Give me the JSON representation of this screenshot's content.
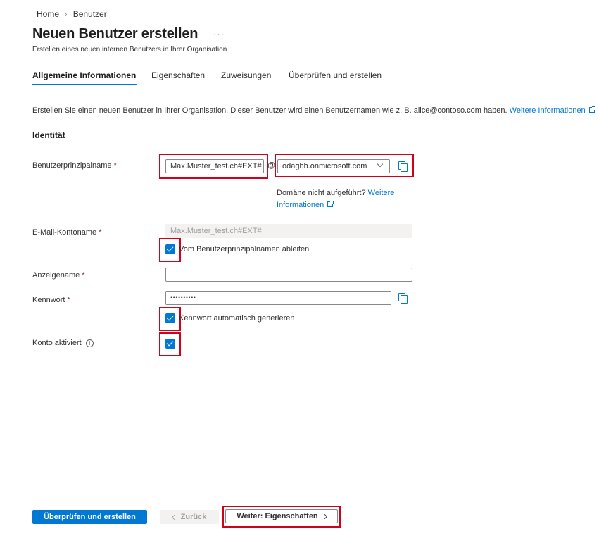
{
  "breadcrumb": {
    "home": "Home",
    "current": "Benutzer"
  },
  "header": {
    "title": "Neuen Benutzer erstellen",
    "more": "···",
    "subtitle": "Erstellen eines neuen internen Benutzers in Ihrer Organisation"
  },
  "tabs": [
    {
      "label": "Allgemeine Informationen",
      "active": true
    },
    {
      "label": "Eigenschaften",
      "active": false
    },
    {
      "label": "Zuweisungen",
      "active": false
    },
    {
      "label": "Überprüfen und erstellen",
      "active": false
    }
  ],
  "intro": {
    "text": "Erstellen Sie einen neuen Benutzer in Ihrer Organisation. Dieser Benutzer wird einen Benutzernamen wie z. B. alice@contoso.com haben.",
    "link": "Weitere Informationen"
  },
  "section_title": "Identität",
  "fields": {
    "upn": {
      "label": "Benutzerprinzipalname",
      "required": "*",
      "value": "Max.Muster_test.ch#EXT#",
      "at": "@",
      "domain": "odagbb.onmicrosoft.com",
      "domain_hint": "Domäne nicht aufgeführt?",
      "domain_hint_link_1": "Weitere",
      "domain_hint_link_2": "Informationen"
    },
    "mail": {
      "label": "E-Mail-Kontoname",
      "required": "*",
      "value": "Max.Muster_test.ch#EXT#",
      "derive_label": "Vom Benutzerprinzipalnamen ableiten",
      "derive_checked": true
    },
    "display_name": {
      "label": "Anzeigename",
      "required": "*",
      "value": ""
    },
    "password": {
      "label": "Kennwort",
      "required": "*",
      "value": "••••••••••",
      "auto_label": "Kennwort automatisch generieren",
      "auto_checked": true
    },
    "account_enabled": {
      "label": "Konto aktiviert",
      "info": "i",
      "checked": true
    }
  },
  "footer": {
    "review_create": "Überprüfen und erstellen",
    "back": "Zurück",
    "next": "Weiter: Eigenschaften"
  },
  "colors": {
    "accent": "#0078d4",
    "highlight": "#d0021b",
    "required": "#a4262c"
  }
}
